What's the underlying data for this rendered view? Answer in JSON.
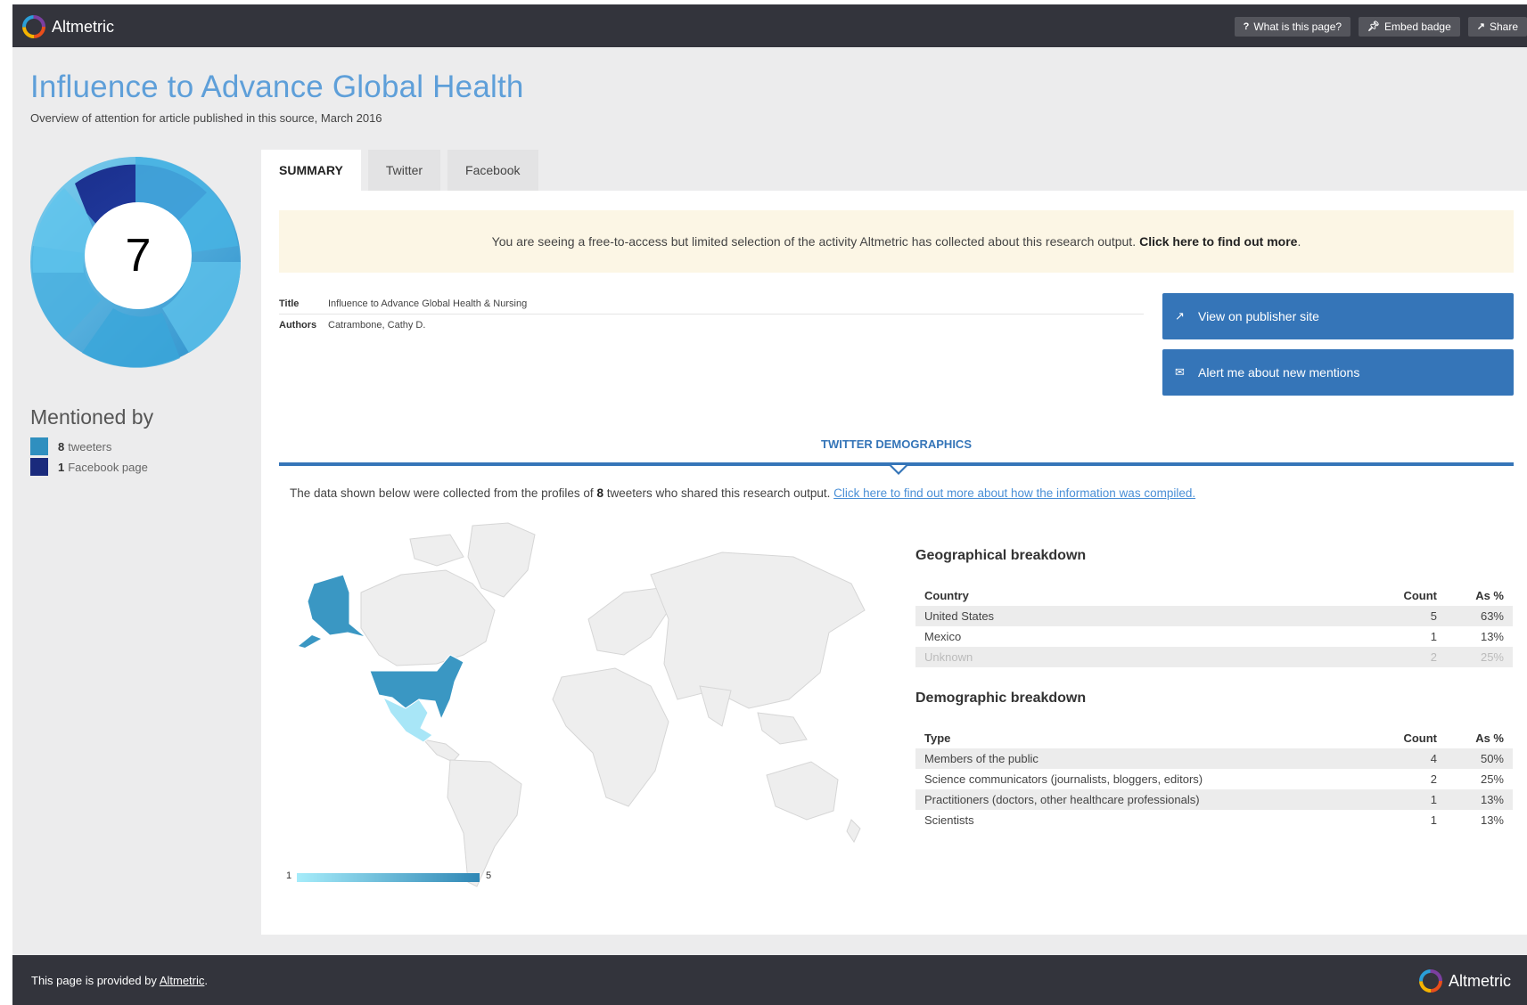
{
  "header": {
    "brand": "Altmetric",
    "actions": [
      {
        "label": "What is this page?",
        "icon": "question-icon"
      },
      {
        "label": "Embed badge",
        "icon": "pin-icon"
      },
      {
        "label": "Share",
        "icon": "share-icon"
      }
    ]
  },
  "page": {
    "title": "Influence to Advance Global Health",
    "subtitle": "Overview of attention for article published in this source, March 2016"
  },
  "badge": {
    "score": "7"
  },
  "mentioned": {
    "title": "Mentioned by",
    "items": [
      {
        "count": "8",
        "label": "tweeters",
        "color": "#2f8fbf"
      },
      {
        "count": "1",
        "label": "Facebook page",
        "color": "#1a2a7c"
      }
    ]
  },
  "tabs": [
    {
      "label": "SUMMARY",
      "active": true
    },
    {
      "label": "Twitter",
      "active": false
    },
    {
      "label": "Facebook",
      "active": false
    }
  ],
  "notice": {
    "text": "You are seeing a free-to-access but limited selection of the activity Altmetric has collected about this research output.",
    "link": "Click here to find out more",
    "suffix": "."
  },
  "article": {
    "title_key": "Title",
    "title_val": "Influence to Advance Global Health & Nursing",
    "authors_key": "Authors",
    "authors_val": "Catrambone, Cathy D."
  },
  "actions": {
    "publisher": "View on publisher site",
    "alert": "Alert me about new mentions"
  },
  "demographics": {
    "heading": "TWITTER DEMOGRAPHICS",
    "intro_pre": "The data shown below were collected from the profiles of",
    "intro_count": "8",
    "intro_post": "tweeters who shared this research output.",
    "intro_link": "Click here to find out more about how the information was compiled.",
    "legend_min": "1",
    "legend_max": "5"
  },
  "geo": {
    "title": "Geographical breakdown",
    "headers": [
      "Country",
      "Count",
      "As %"
    ],
    "rows": [
      [
        "United States",
        "5",
        "63%"
      ],
      [
        "Mexico",
        "1",
        "13%"
      ],
      [
        "Unknown",
        "2",
        "25%"
      ]
    ]
  },
  "demo": {
    "title": "Demographic breakdown",
    "headers": [
      "Type",
      "Count",
      "As %"
    ],
    "rows": [
      [
        "Members of the public",
        "4",
        "50%"
      ],
      [
        "Science communicators (journalists, bloggers, editors)",
        "2",
        "25%"
      ],
      [
        "Practitioners (doctors, other healthcare professionals)",
        "1",
        "13%"
      ],
      [
        "Scientists",
        "1",
        "13%"
      ]
    ]
  },
  "footer": {
    "text_pre": "This page is provided by",
    "link": "Altmetric",
    "text_post": ".",
    "brand": "Altmetric"
  }
}
